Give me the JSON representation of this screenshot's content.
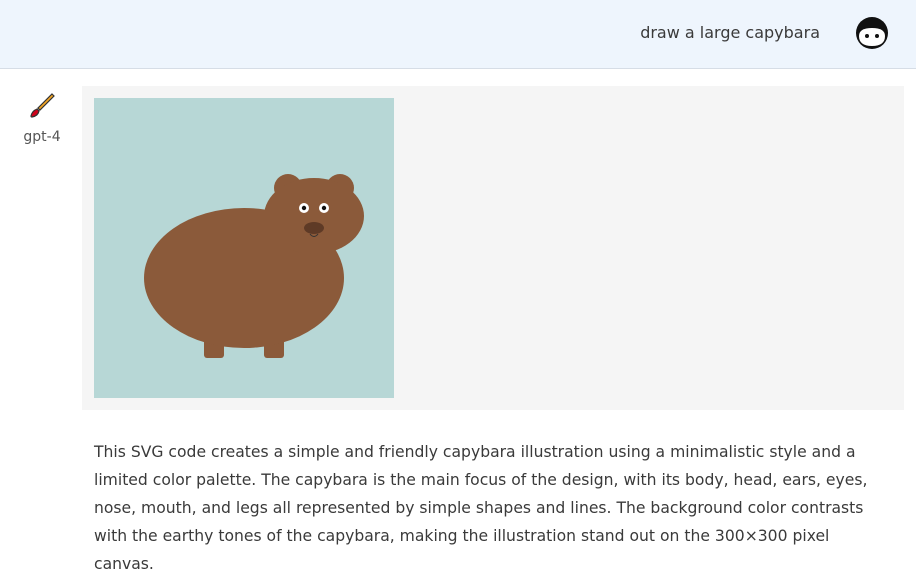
{
  "user_message": {
    "text": "draw a large capybara",
    "avatar_icon": "user-face-icon"
  },
  "assistant": {
    "model": "gpt-4",
    "model_icon": "paintbrush-icon",
    "image": {
      "subject": "capybara",
      "background_color": "#b7d7d6",
      "body_color": "#8b5a3a",
      "nose_color": "#5e3a26"
    },
    "description": "This SVG code creates a simple and friendly capybara illustration using a minimalistic style and a limited color palette. The capybara is the main focus of the design, with its body, head, ears, eyes, nose, mouth, and legs all represented by simple shapes and lines. The background color contrasts with the earthy tones of the capybara, making the illustration stand out on the 300×300 pixel canvas."
  },
  "colors": {
    "header_bg": "#eef5fd",
    "panel_bg": "#f5f5f5",
    "brush_handle": "#f5a623",
    "brush_tip": "#d0021b"
  }
}
